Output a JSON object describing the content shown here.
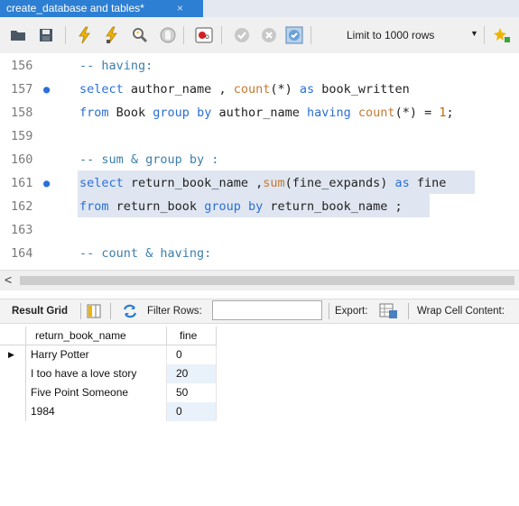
{
  "tab": {
    "title": "create_database and tables*",
    "close_glyph": "×"
  },
  "toolbar": {
    "limit_label": "Limit to 1000 rows",
    "icons": [
      "folder-icon",
      "save-icon",
      "execute-icon",
      "execute-current-icon",
      "explain-icon",
      "stop-icon",
      "toggle-continue-on-error-icon",
      "commit-icon",
      "rollback-icon",
      "autocommit-icon",
      "beautify-icon"
    ]
  },
  "editor": {
    "lines": [
      {
        "num": "156",
        "dot": "",
        "tokens": [
          [
            "cm",
            "-- having:"
          ]
        ]
      },
      {
        "num": "157",
        "dot": "●",
        "tokens": [
          [
            "kw",
            "select"
          ],
          [
            "txt",
            " author_name , "
          ],
          [
            "fn",
            "count"
          ],
          [
            "txt",
            "(*) "
          ],
          [
            "kw",
            "as"
          ],
          [
            "txt",
            " book_written"
          ]
        ]
      },
      {
        "num": "158",
        "dot": "",
        "tokens": [
          [
            "kw",
            "from"
          ],
          [
            "txt",
            " Book "
          ],
          [
            "kw",
            "group by"
          ],
          [
            "txt",
            " author_name "
          ],
          [
            "kw",
            "having"
          ],
          [
            "txt",
            " "
          ],
          [
            "fn",
            "count"
          ],
          [
            "txt",
            "(*) = "
          ],
          [
            "numlit",
            "1"
          ],
          [
            "txt",
            ";"
          ]
        ]
      },
      {
        "num": "159",
        "dot": "",
        "tokens": []
      },
      {
        "num": "160",
        "dot": "",
        "tokens": [
          [
            "cm",
            "-- sum & group by :"
          ]
        ]
      },
      {
        "num": "161",
        "dot": "●",
        "tokens": [
          [
            "kw",
            "select"
          ],
          [
            "txt",
            " return_book_name ,"
          ],
          [
            "fn",
            "sum"
          ],
          [
            "txt",
            "(fine_expands) "
          ],
          [
            "kw",
            "as"
          ],
          [
            "txt",
            " fine"
          ]
        ]
      },
      {
        "num": "162",
        "dot": "",
        "tokens": [
          [
            "kw",
            "from"
          ],
          [
            "txt",
            " return_book "
          ],
          [
            "kw",
            "group by"
          ],
          [
            "txt",
            " return_book_name ;"
          ]
        ]
      },
      {
        "num": "163",
        "dot": "",
        "tokens": []
      },
      {
        "num": "164",
        "dot": "",
        "tokens": [
          [
            "cm",
            "-- count & having:"
          ]
        ]
      }
    ]
  },
  "scroll": {
    "left_arrow": "<"
  },
  "result_toolbar": {
    "result_grid": "Result Grid",
    "filter_rows": "Filter Rows:",
    "filter_value": "",
    "export": "Export:",
    "wrap": "Wrap Cell Content:"
  },
  "grid": {
    "columns": [
      "return_book_name",
      "fine"
    ],
    "rows": [
      [
        "Harry Potter",
        "0"
      ],
      [
        "I too have a love story",
        "20"
      ],
      [
        "Five Point Someone",
        "50"
      ],
      [
        "1984",
        "0"
      ]
    ],
    "current_row_marker": "▶"
  },
  "colors": {
    "tab_active": "#2d7fd3",
    "keyword": "#2b6fd6",
    "selection": "#dfe6f1",
    "alt_row": "#e9f1fb"
  }
}
